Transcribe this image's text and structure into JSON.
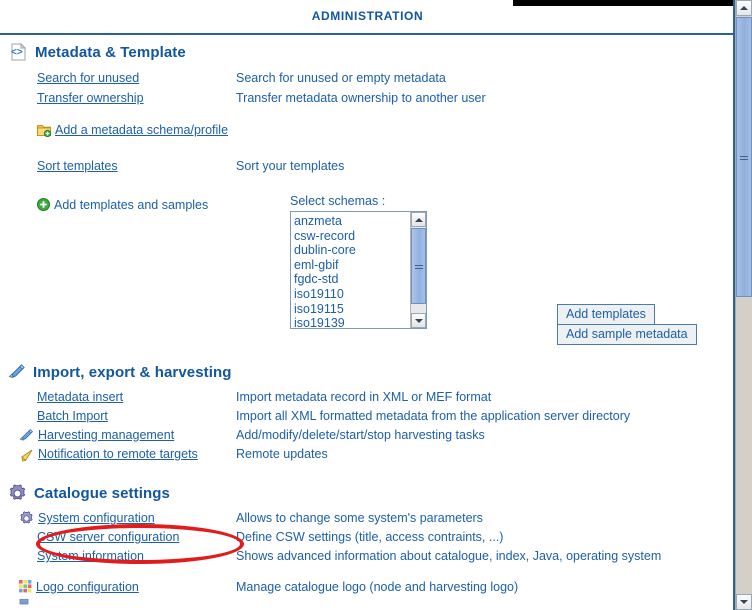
{
  "page": {
    "title": "ADMINISTRATION"
  },
  "sections": [
    {
      "id": "metadata-template",
      "icon": "xml-document-icon",
      "heading": "Metadata & Template",
      "rows": [
        {
          "link": "Search for unused",
          "icon": null,
          "desc": "Search for unused or empty metadata"
        },
        {
          "link": "Transfer ownership",
          "icon": null,
          "desc": "Transfer metadata ownership to another user"
        },
        {
          "link": "Add a metadata schema/profile",
          "icon": "folder-add-icon",
          "desc": ""
        },
        {
          "link": "Sort templates",
          "icon": null,
          "desc": "Sort your templates"
        },
        {
          "link": "Add templates and samples",
          "icon": "green-plus-icon",
          "desc": "",
          "not_a_link": true
        }
      ]
    },
    {
      "id": "import-export-harvesting",
      "icon": "pen-icon",
      "heading": "Import, export & harvesting",
      "rows": [
        {
          "link": "Metadata insert",
          "icon": null,
          "desc": "Import metadata record in XML or MEF format"
        },
        {
          "link": "Batch Import",
          "icon": null,
          "desc": "Import all XML formatted metadata from the application server directory"
        },
        {
          "link": "Harvesting management",
          "icon": "pen-icon",
          "desc": "Add/modify/delete/start/stop harvesting tasks"
        },
        {
          "link": "Notification to remote targets",
          "icon": "megaphone-icon",
          "desc": "Remote updates"
        }
      ]
    },
    {
      "id": "catalogue-settings",
      "icon": "gear-icon",
      "heading": "Catalogue settings",
      "rows": [
        {
          "link": "System configuration",
          "icon": "gear-small-icon",
          "desc": "Allows to change some system's parameters"
        },
        {
          "link": "CSW server configuration",
          "icon": null,
          "desc": "Define CSW settings (title, access contraints, ...)",
          "annotated": true
        },
        {
          "link": "System information",
          "icon": null,
          "desc": "Shows advanced information about catalogue, index, Java, operating system"
        },
        {
          "link": "Logo configuration",
          "icon": "mosaic-icon",
          "desc": "Manage catalogue logo (node and harvesting logo)"
        }
      ]
    }
  ],
  "schemas": {
    "label": "Select schemas :",
    "options": [
      "anzmeta",
      "csw-record",
      "dublin-core",
      "eml-gbif",
      "fgdc-std",
      "iso19110",
      "iso19115",
      "iso19139"
    ]
  },
  "buttons": {
    "add_templates": "Add templates",
    "add_sample_metadata": "Add sample metadata"
  },
  "annotation": {
    "color": "#e21b1b",
    "target": "CSW server configuration"
  },
  "colors": {
    "link": "#1d5fa8",
    "heading": "#1256a0",
    "rule": "#2a6496",
    "annotation": "#e21b1b"
  }
}
